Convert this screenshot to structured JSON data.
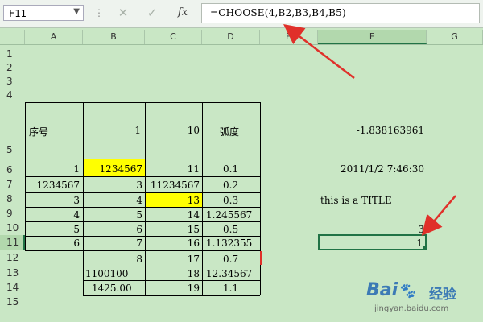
{
  "formula_bar": {
    "name_box": "F11",
    "dots": "⋮",
    "cancel_icon": "✕",
    "enter_icon": "✓",
    "fx_label": "fx",
    "formula": "=CHOOSE(4,B2,B3,B4,B5)"
  },
  "columns": [
    "A",
    "B",
    "C",
    "D",
    "E",
    "F",
    "G"
  ],
  "rows": [
    "1",
    "2",
    "3",
    "4",
    "5",
    "6",
    "7",
    "8",
    "9",
    "10",
    "11",
    "12",
    "13",
    "14",
    "15"
  ],
  "cells": {
    "A5": "序号",
    "B5": "1",
    "C5": "10",
    "D5": "弧度",
    "F5": "-1.838163961",
    "A6": "1",
    "B6": "1234567",
    "C6": "11",
    "D6": "0.1",
    "F6": "2011/1/2 7:46:30",
    "A7": "1234567",
    "B7": "3",
    "C7": "11234567",
    "D7": "0.2",
    "A8": "3",
    "B8": "4",
    "C8": "13",
    "D8": "0.3",
    "F8": "this is a TITLE",
    "A9": "4",
    "B9": "5",
    "C9": "14",
    "D9": "1.245567",
    "A10": "5",
    "B10": "6",
    "C10": "15",
    "D10": "0.5",
    "F10": "3",
    "A11": "6",
    "B11": "7",
    "C11": "16",
    "D11": "1.132355",
    "F11": "1",
    "B12": "8",
    "C12": "17",
    "D12": "0.7",
    "B13": "1100100",
    "C13": "18",
    "D13": "12.34567",
    "B14": "1425.00",
    "C14": "19",
    "D14": "1.1"
  },
  "highlight_color": "#ffff00",
  "selection_color": "#217346",
  "annotation_color": "#e0302a",
  "watermark": {
    "logo": "Bai",
    "paw": "du",
    "text": "经验",
    "url": "jingyan.baidu.com"
  }
}
